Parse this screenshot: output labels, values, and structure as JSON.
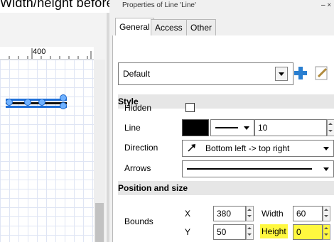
{
  "caption": "Width/height before the compilation",
  "ruler": {
    "label_400": "400"
  },
  "dialog": {
    "title": "Properties of Line 'Line'",
    "tabs": [
      {
        "label": "General",
        "active": true
      },
      {
        "label": "Access",
        "active": false
      },
      {
        "label": "Other",
        "active": false
      }
    ],
    "preset": {
      "value": "Default"
    },
    "style_section": "Style",
    "hidden_label": "Hidden",
    "line_label": "Line",
    "line_width": "10",
    "direction_label": "Direction",
    "direction_value": "Bottom left -> top right",
    "arrows_label": "Arrows",
    "position_section": "Position and size",
    "bounds_label": "Bounds",
    "x_label": "X",
    "x_value": "380",
    "y_label": "Y",
    "y_value": "50",
    "width_label": "Width",
    "width_value": "60",
    "height_label": "Height",
    "height_value": "0"
  },
  "colors": {
    "line_blue": "#1e6fd9",
    "highlight_yellow": "#fff83f",
    "plus_icon": "#2a7fd0",
    "line_swatch": "#000000"
  }
}
